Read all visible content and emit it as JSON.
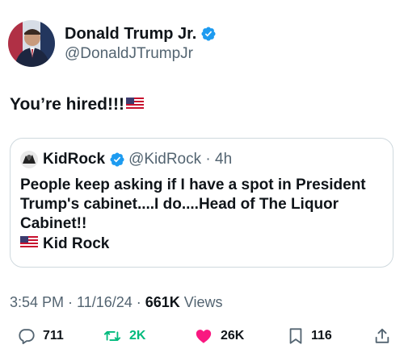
{
  "author": {
    "display_name": "Donald Trump Jr.",
    "handle": "@DonaldJTrumpJr"
  },
  "tweet": {
    "text": "You’re hired!!!"
  },
  "quoted_tweet": {
    "display_name": "KidRock",
    "meta": "@KidRock · 4h",
    "text": "People keep asking if I have a spot in President Trump's cabinet....I do....Head of The Liquor Cabinet!!",
    "signature": "Kid Rock"
  },
  "footer": {
    "time_date": "3:54 PM · 11/16/24 · ",
    "views_count": "661K",
    "views_label": " Views"
  },
  "actions": {
    "replies": "711",
    "reposts": "2K",
    "likes": "26K",
    "bookmarks": "116"
  },
  "colors": {
    "verified_blue": "#1d9bf0",
    "repost_green": "#00ba7c",
    "like_pink": "#f91880",
    "secondary_text": "#536471"
  },
  "icons": [
    "verified-badge-icon",
    "us-flag-icon",
    "reply-icon",
    "repost-icon",
    "like-icon",
    "bookmark-icon",
    "share-icon"
  ]
}
